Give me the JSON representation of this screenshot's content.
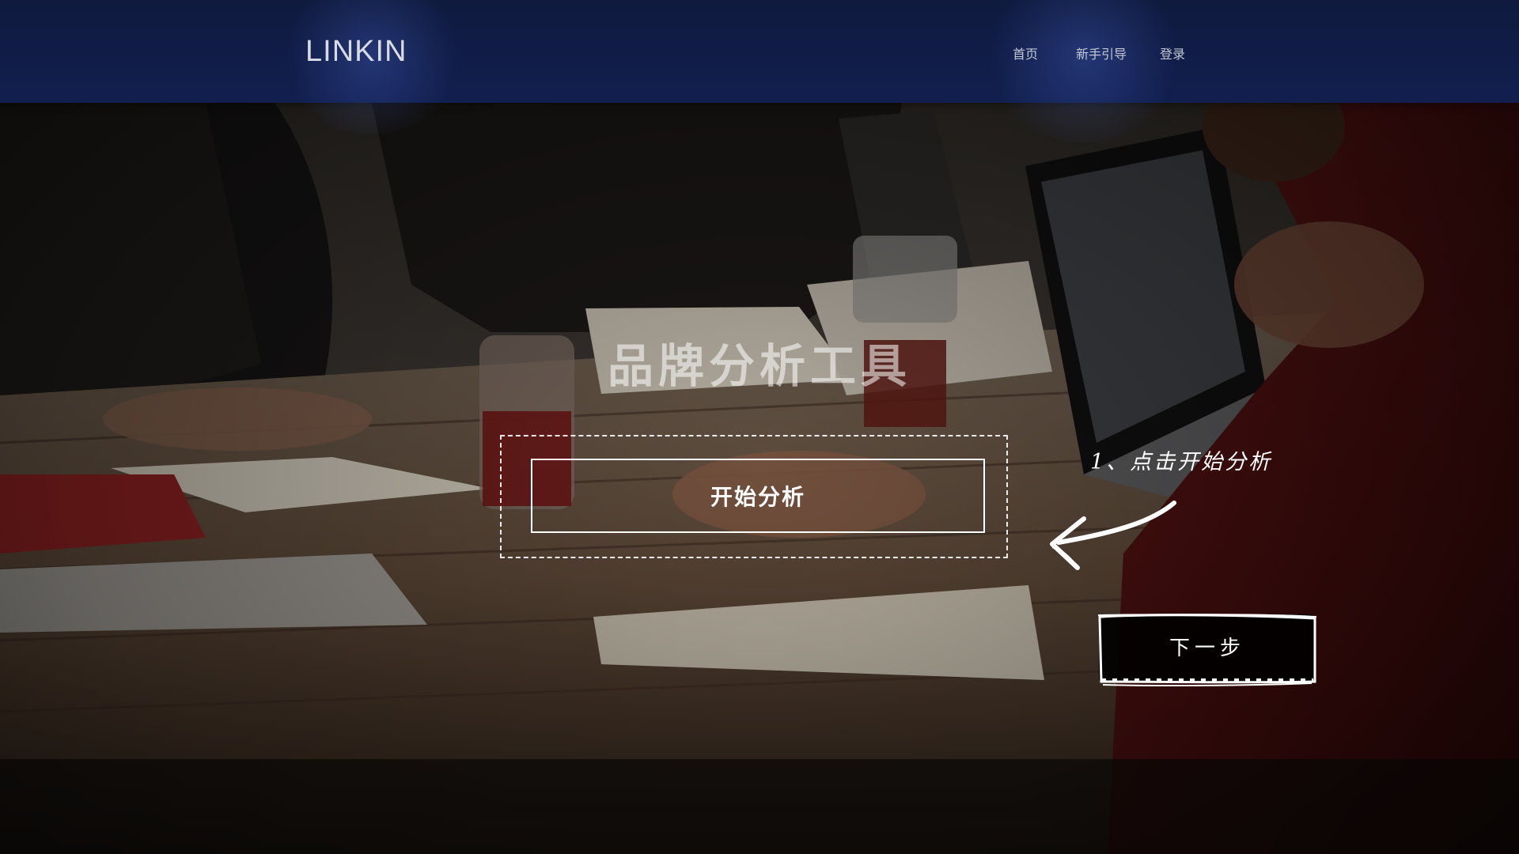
{
  "navbar": {
    "logo": "LINKIN",
    "links": [
      "首页",
      "新手引导",
      "登录"
    ]
  },
  "main": {
    "title": "品牌分析工具",
    "start_button": "开始分析"
  },
  "guide": {
    "hint": "1、点击开始分析",
    "next_button": "下一步"
  },
  "colors": {
    "navbar": "#121f4f",
    "accent": "#ffffff"
  }
}
